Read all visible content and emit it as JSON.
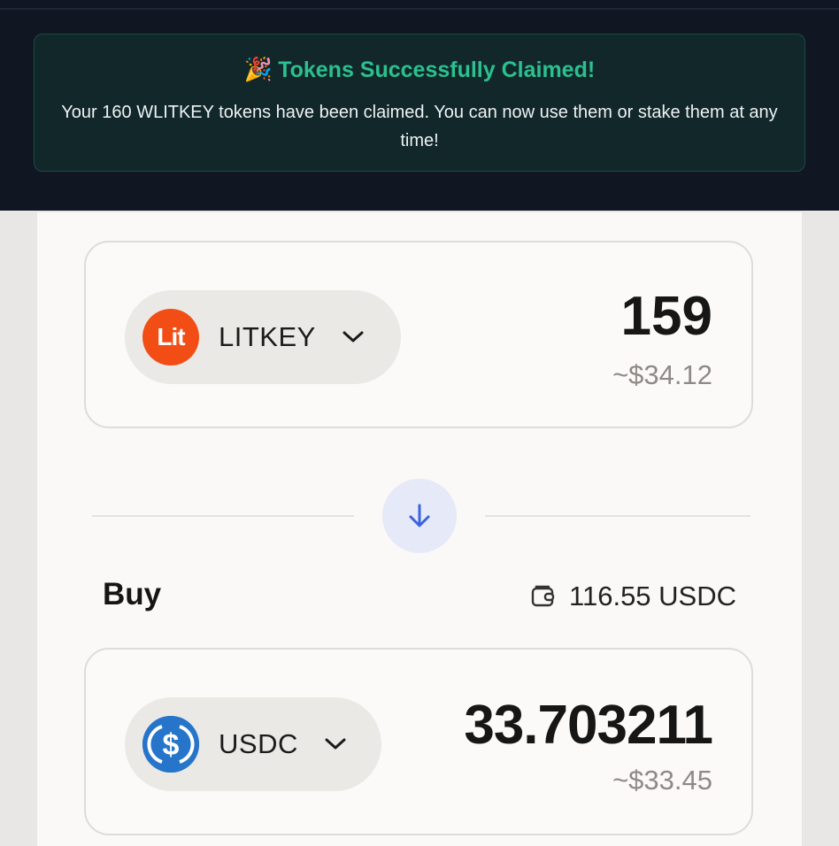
{
  "notification": {
    "icon": "party-popper-icon",
    "emoji": "🎉",
    "title": "Tokens Successfully Claimed!",
    "message": "Your 160 WLITKEY tokens have been claimed. You can now use them or stake them at any time!"
  },
  "sell": {
    "token_logo_text": "Lit",
    "token_symbol": "LITKEY",
    "amount": "159",
    "fiat_value": "~$34.12"
  },
  "swap": {
    "icon": "arrow-down-icon"
  },
  "buy": {
    "label": "Buy",
    "balance": "116.55 USDC",
    "token_symbol": "USDC",
    "amount": "33.703211",
    "fiat_value": "~$33.45"
  },
  "colors": {
    "notification_title": "#2bc08e",
    "lit_brand": "#f24d15",
    "usdc_brand": "#2775ca",
    "swap_accent": "#3b63e0"
  }
}
